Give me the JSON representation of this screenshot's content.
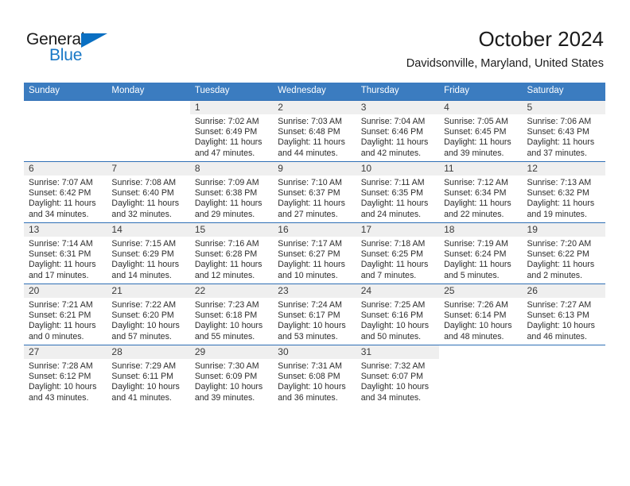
{
  "brand": {
    "name_part1": "General",
    "name_part2": "Blue",
    "triangle_color": "#0a6fc2",
    "blue_text_color": "#1878c6"
  },
  "header": {
    "title": "October 2024",
    "subtitle": "Davidsonville, Maryland, United States"
  },
  "theme": {
    "header_bg": "#3b7cc0",
    "header_text": "#ffffff",
    "row_divider": "#2f6fb5",
    "daynum_band": "#efefef"
  },
  "weekdays": [
    {
      "label": "Sunday"
    },
    {
      "label": "Monday"
    },
    {
      "label": "Tuesday"
    },
    {
      "label": "Wednesday"
    },
    {
      "label": "Thursday"
    },
    {
      "label": "Friday"
    },
    {
      "label": "Saturday"
    }
  ],
  "weeks": [
    [
      {
        "empty": true
      },
      {
        "empty": true
      },
      {
        "day": "1",
        "sunrise": "Sunrise: 7:02 AM",
        "sunset": "Sunset: 6:49 PM",
        "daylight": "Daylight: 11 hours and 47 minutes."
      },
      {
        "day": "2",
        "sunrise": "Sunrise: 7:03 AM",
        "sunset": "Sunset: 6:48 PM",
        "daylight": "Daylight: 11 hours and 44 minutes."
      },
      {
        "day": "3",
        "sunrise": "Sunrise: 7:04 AM",
        "sunset": "Sunset: 6:46 PM",
        "daylight": "Daylight: 11 hours and 42 minutes."
      },
      {
        "day": "4",
        "sunrise": "Sunrise: 7:05 AM",
        "sunset": "Sunset: 6:45 PM",
        "daylight": "Daylight: 11 hours and 39 minutes."
      },
      {
        "day": "5",
        "sunrise": "Sunrise: 7:06 AM",
        "sunset": "Sunset: 6:43 PM",
        "daylight": "Daylight: 11 hours and 37 minutes."
      }
    ],
    [
      {
        "day": "6",
        "sunrise": "Sunrise: 7:07 AM",
        "sunset": "Sunset: 6:42 PM",
        "daylight": "Daylight: 11 hours and 34 minutes."
      },
      {
        "day": "7",
        "sunrise": "Sunrise: 7:08 AM",
        "sunset": "Sunset: 6:40 PM",
        "daylight": "Daylight: 11 hours and 32 minutes."
      },
      {
        "day": "8",
        "sunrise": "Sunrise: 7:09 AM",
        "sunset": "Sunset: 6:38 PM",
        "daylight": "Daylight: 11 hours and 29 minutes."
      },
      {
        "day": "9",
        "sunrise": "Sunrise: 7:10 AM",
        "sunset": "Sunset: 6:37 PM",
        "daylight": "Daylight: 11 hours and 27 minutes."
      },
      {
        "day": "10",
        "sunrise": "Sunrise: 7:11 AM",
        "sunset": "Sunset: 6:35 PM",
        "daylight": "Daylight: 11 hours and 24 minutes."
      },
      {
        "day": "11",
        "sunrise": "Sunrise: 7:12 AM",
        "sunset": "Sunset: 6:34 PM",
        "daylight": "Daylight: 11 hours and 22 minutes."
      },
      {
        "day": "12",
        "sunrise": "Sunrise: 7:13 AM",
        "sunset": "Sunset: 6:32 PM",
        "daylight": "Daylight: 11 hours and 19 minutes."
      }
    ],
    [
      {
        "day": "13",
        "sunrise": "Sunrise: 7:14 AM",
        "sunset": "Sunset: 6:31 PM",
        "daylight": "Daylight: 11 hours and 17 minutes."
      },
      {
        "day": "14",
        "sunrise": "Sunrise: 7:15 AM",
        "sunset": "Sunset: 6:29 PM",
        "daylight": "Daylight: 11 hours and 14 minutes."
      },
      {
        "day": "15",
        "sunrise": "Sunrise: 7:16 AM",
        "sunset": "Sunset: 6:28 PM",
        "daylight": "Daylight: 11 hours and 12 minutes."
      },
      {
        "day": "16",
        "sunrise": "Sunrise: 7:17 AM",
        "sunset": "Sunset: 6:27 PM",
        "daylight": "Daylight: 11 hours and 10 minutes."
      },
      {
        "day": "17",
        "sunrise": "Sunrise: 7:18 AM",
        "sunset": "Sunset: 6:25 PM",
        "daylight": "Daylight: 11 hours and 7 minutes."
      },
      {
        "day": "18",
        "sunrise": "Sunrise: 7:19 AM",
        "sunset": "Sunset: 6:24 PM",
        "daylight": "Daylight: 11 hours and 5 minutes."
      },
      {
        "day": "19",
        "sunrise": "Sunrise: 7:20 AM",
        "sunset": "Sunset: 6:22 PM",
        "daylight": "Daylight: 11 hours and 2 minutes."
      }
    ],
    [
      {
        "day": "20",
        "sunrise": "Sunrise: 7:21 AM",
        "sunset": "Sunset: 6:21 PM",
        "daylight": "Daylight: 11 hours and 0 minutes."
      },
      {
        "day": "21",
        "sunrise": "Sunrise: 7:22 AM",
        "sunset": "Sunset: 6:20 PM",
        "daylight": "Daylight: 10 hours and 57 minutes."
      },
      {
        "day": "22",
        "sunrise": "Sunrise: 7:23 AM",
        "sunset": "Sunset: 6:18 PM",
        "daylight": "Daylight: 10 hours and 55 minutes."
      },
      {
        "day": "23",
        "sunrise": "Sunrise: 7:24 AM",
        "sunset": "Sunset: 6:17 PM",
        "daylight": "Daylight: 10 hours and 53 minutes."
      },
      {
        "day": "24",
        "sunrise": "Sunrise: 7:25 AM",
        "sunset": "Sunset: 6:16 PM",
        "daylight": "Daylight: 10 hours and 50 minutes."
      },
      {
        "day": "25",
        "sunrise": "Sunrise: 7:26 AM",
        "sunset": "Sunset: 6:14 PM",
        "daylight": "Daylight: 10 hours and 48 minutes."
      },
      {
        "day": "26",
        "sunrise": "Sunrise: 7:27 AM",
        "sunset": "Sunset: 6:13 PM",
        "daylight": "Daylight: 10 hours and 46 minutes."
      }
    ],
    [
      {
        "day": "27",
        "sunrise": "Sunrise: 7:28 AM",
        "sunset": "Sunset: 6:12 PM",
        "daylight": "Daylight: 10 hours and 43 minutes."
      },
      {
        "day": "28",
        "sunrise": "Sunrise: 7:29 AM",
        "sunset": "Sunset: 6:11 PM",
        "daylight": "Daylight: 10 hours and 41 minutes."
      },
      {
        "day": "29",
        "sunrise": "Sunrise: 7:30 AM",
        "sunset": "Sunset: 6:09 PM",
        "daylight": "Daylight: 10 hours and 39 minutes."
      },
      {
        "day": "30",
        "sunrise": "Sunrise: 7:31 AM",
        "sunset": "Sunset: 6:08 PM",
        "daylight": "Daylight: 10 hours and 36 minutes."
      },
      {
        "day": "31",
        "sunrise": "Sunrise: 7:32 AM",
        "sunset": "Sunset: 6:07 PM",
        "daylight": "Daylight: 10 hours and 34 minutes."
      },
      {
        "empty": true
      },
      {
        "empty": true
      }
    ]
  ]
}
